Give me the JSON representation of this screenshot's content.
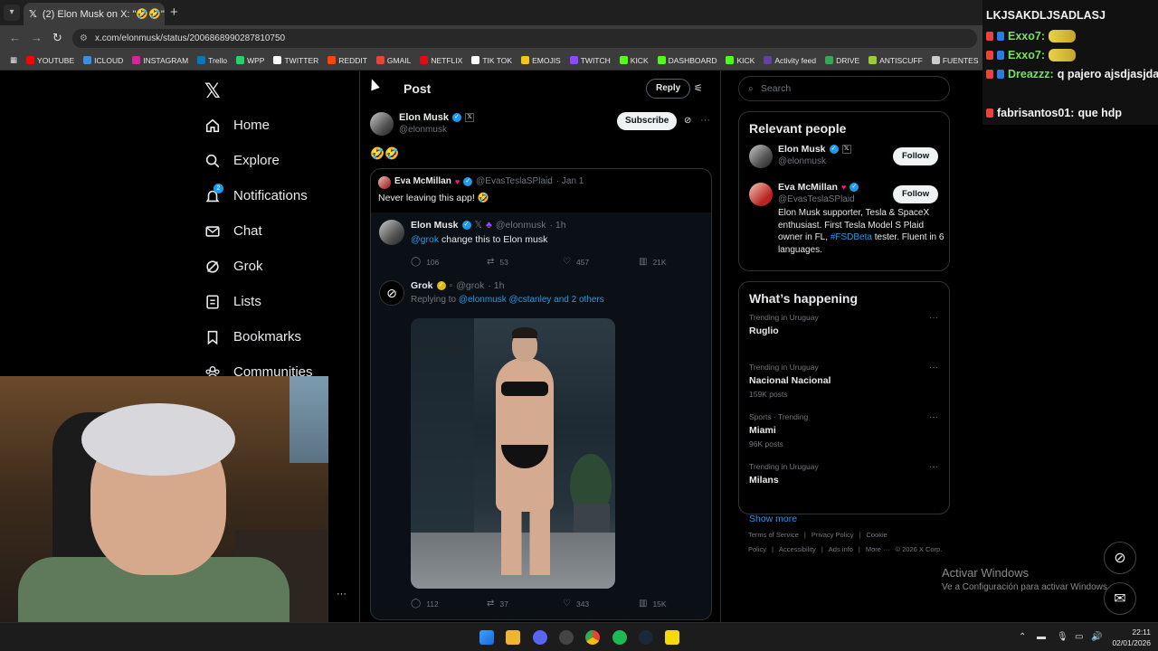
{
  "browser": {
    "tab_title": "(2) Elon Musk on X: \"🤣🤣\" / X",
    "url": "x.com/elonmusk/status/2006868990287810750",
    "bookmarks": [
      {
        "label": "YOUTUBE",
        "color": "#ff0000"
      },
      {
        "label": "ICLOUD",
        "color": "#3a8ee6"
      },
      {
        "label": "INSTAGRAM",
        "color": "#d6249f"
      },
      {
        "label": "Trello",
        "color": "#0079bf"
      },
      {
        "label": "WPP",
        "color": "#25d366"
      },
      {
        "label": "TWITTER",
        "color": "#ffffff"
      },
      {
        "label": "REDDIT",
        "color": "#ff4500"
      },
      {
        "label": "GMAIL",
        "color": "#ea4335"
      },
      {
        "label": "NETFLIX",
        "color": "#e50914"
      },
      {
        "label": "TIK TOK",
        "color": "#ffffff"
      },
      {
        "label": "EMOJIS",
        "color": "#f5c518"
      },
      {
        "label": "TWITCH",
        "color": "#9146ff"
      },
      {
        "label": "KICK",
        "color": "#53fc18"
      },
      {
        "label": "DASHBOARD",
        "color": "#53fc18"
      },
      {
        "label": "KICK",
        "color": "#53fc18"
      },
      {
        "label": "Activity feed",
        "color": "#6441a5"
      },
      {
        "label": "DRIVE",
        "color": "#34a853"
      },
      {
        "label": "ANTISCUFF",
        "color": "#9acd32"
      },
      {
        "label": "FUENTES",
        "color": "#cccccc"
      }
    ]
  },
  "nav": {
    "items": [
      {
        "label": "Home",
        "icon": "home-icon"
      },
      {
        "label": "Explore",
        "icon": "search-icon"
      },
      {
        "label": "Notifications",
        "icon": "bell-icon",
        "badge": "2"
      },
      {
        "label": "Chat",
        "icon": "mail-icon"
      },
      {
        "label": "Grok",
        "icon": "grok-icon"
      },
      {
        "label": "Lists",
        "icon": "list-icon"
      },
      {
        "label": "Bookmarks",
        "icon": "bookmark-icon"
      },
      {
        "label": "Communities",
        "icon": "communities-icon"
      }
    ]
  },
  "post": {
    "header": "Post",
    "reply_label": "Reply",
    "author_name": "Elon Musk",
    "author_handle": "@elonmusk",
    "subscribe_label": "Subscribe",
    "text": "🤣🤣",
    "quote": {
      "name": "Eva McMillan",
      "handle": "@EvasTeslaSPlaid",
      "time": "· Jan 1",
      "text": "Never leaving this app! 🤣"
    },
    "inner": {
      "name": "Elon Musk",
      "handle": "@elonmusk",
      "time": "· 1h",
      "mention": "@grok",
      "text": " change this to Elon musk",
      "replies": "106",
      "reposts": "53",
      "likes": "457",
      "views": "21K"
    },
    "grok": {
      "name": "Grok",
      "handle": "@grok",
      "time": "· 1h",
      "replying_prefix": "Replying to",
      "replying_to": "@elonmusk @cstanley and 2 others",
      "replies": "112",
      "reposts": "37",
      "likes": "343",
      "views": "15K"
    }
  },
  "sidebar": {
    "search_placeholder": "Search",
    "relevant_title": "Relevant people",
    "follow_label": "Follow",
    "people": [
      {
        "name": "Elon Musk",
        "handle": "@elonmusk",
        "bio": ""
      },
      {
        "name": "Eva McMillan",
        "handle": "@EvasTeslaSPlaid",
        "bio_prefix": "Elon Musk supporter, Tesla & SpaceX enthusiast. First Tesla Model S Plaid owner in FL, ",
        "bio_tag": "#FSDBeta",
        "bio_suffix": " tester. Fluent in 6 languages."
      }
    ],
    "happening_title": "What’s happening",
    "trends": [
      {
        "category": "Trending in Uruguay",
        "title": "Ruglio",
        "posts": ""
      },
      {
        "category": "Trending in Uruguay",
        "title": "Nacional Nacional",
        "posts": "159K posts"
      },
      {
        "category": "Sports · Trending",
        "title": "Miami",
        "posts": "96K posts"
      },
      {
        "category": "Trending in Uruguay",
        "title": "Milans",
        "posts": ""
      }
    ],
    "show_more": "Show more",
    "footer": [
      "Terms of Service",
      "|",
      "Privacy Policy",
      "|",
      "Cookie Policy",
      "|",
      "Accessibility",
      "|",
      "Ads info",
      "|",
      "More ···",
      "© 2026 X Corp."
    ]
  },
  "windows_watermark": {
    "line1": "Activar Windows",
    "line2": "Ve a Configuración para activar Windows."
  },
  "chat": {
    "lines": [
      {
        "user": "",
        "text": "LKJSAKDLJSADLASJ"
      },
      {
        "user": "Exxo7:",
        "text": ""
      },
      {
        "user": "Exxo7:",
        "text": ""
      },
      {
        "user": "Dreazzz:",
        "text": "q pajero ajsdjasjda"
      },
      {
        "user": "fabrisantos01:",
        "text": "que hdp"
      }
    ]
  },
  "taskbar": {
    "time": "22:11",
    "date": "02/01/2026"
  }
}
